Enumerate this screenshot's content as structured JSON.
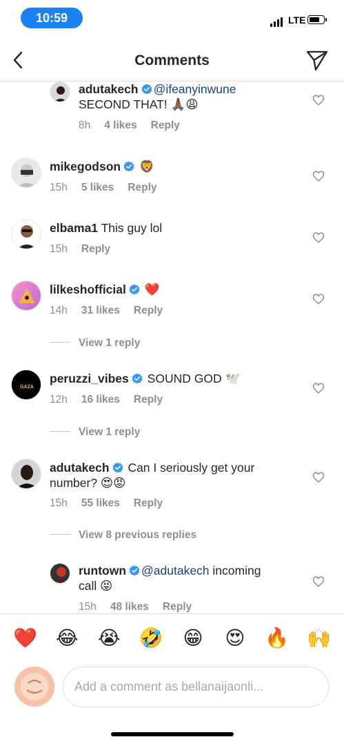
{
  "status_bar": {
    "time": "10:59",
    "network": "LTE"
  },
  "nav": {
    "title": "Comments"
  },
  "comments": [
    {
      "username": "adutakech",
      "verified": true,
      "mention": "@ifeanyinwune",
      "text_line1": " ",
      "line2": "SECOND THAT! 🙏🏾😩",
      "time": "8h",
      "likes": "4 likes",
      "reply": "Reply"
    },
    {
      "username": "mikegodson",
      "verified": true,
      "text": "🦁",
      "time": "15h",
      "likes": "5 likes",
      "reply": "Reply"
    },
    {
      "username": "elbama1",
      "verified": false,
      "text": "This guy lol",
      "time": "15h",
      "reply": "Reply"
    },
    {
      "username": "lilkeshofficial",
      "verified": true,
      "text": "❤️",
      "time": "14h",
      "likes": "31 likes",
      "reply": "Reply",
      "view_replies": "View 1 reply"
    },
    {
      "username": "peruzzi_vibes",
      "verified": true,
      "text": "SOUND GOD 🕊️",
      "time": "12h",
      "likes": "16 likes",
      "reply": "Reply",
      "view_replies": "View 1 reply",
      "avatar_text": "GAZA"
    },
    {
      "username": "adutakech",
      "verified": true,
      "text": "Can I seriously get your",
      "line2": "number? 😍😡",
      "time": "15h",
      "likes": "55 likes",
      "reply": "Reply",
      "view_replies": "View 8 previous replies"
    },
    {
      "username": "runtown",
      "verified": true,
      "mention": "@adutakech",
      "text": " incoming",
      "line2": "call 😝",
      "time": "15h",
      "likes": "48 likes",
      "reply": "Reply"
    }
  ],
  "emoji_bar": [
    "❤️",
    "😂",
    "😭",
    "🤣",
    "😁",
    "😍",
    "🔥",
    "🙌"
  ],
  "composer": {
    "placeholder": "Add a comment as bellanaijaonli..."
  },
  "colors": {
    "accent": "#1a82f2",
    "verified": "#3897f0",
    "meta": "#8e8e8e",
    "mention": "#1c3f7e"
  },
  "icons": {
    "back": "chevron-left-icon",
    "share": "paper-plane-icon",
    "like": "heart-outline-icon"
  }
}
